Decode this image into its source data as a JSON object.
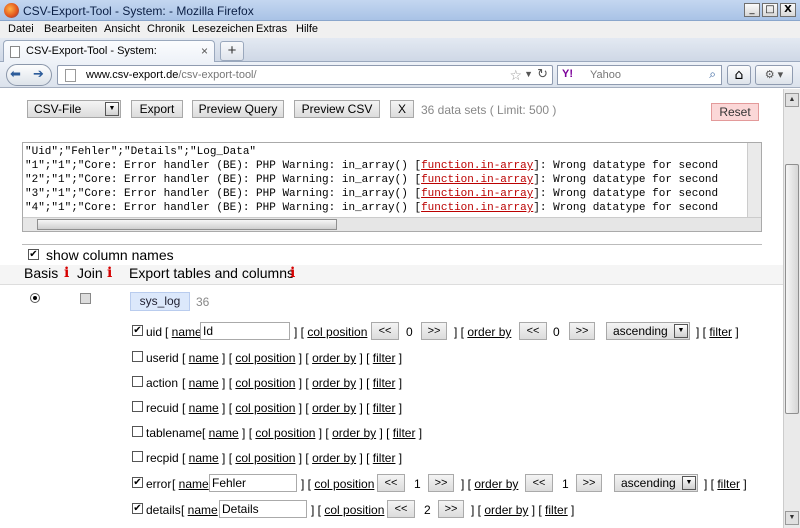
{
  "window": {
    "title": "CSV-Export-Tool - System: - Mozilla Firefox",
    "min": "_",
    "max": "□",
    "close": "X"
  },
  "menu": [
    "Datei",
    "Bearbeiten",
    "Ansicht",
    "Chronik",
    "Lesezeichen",
    "Extras",
    "Hilfe"
  ],
  "tab": {
    "label": "CSV-Export-Tool - System:",
    "close": "×",
    "new": "+"
  },
  "nav": {
    "url_host": "www.csv-export.de",
    "url_path": "/csv-export-tool/",
    "search_engine": "Y!",
    "search_placeholder": "Yahoo"
  },
  "toolbar": {
    "format": "CSV-File",
    "export": "Export",
    "preview_query": "Preview Query",
    "preview_csv": "Preview CSV",
    "x": "X",
    "status": "36 data sets ( Limit: 500 )",
    "reset": "Reset"
  },
  "csv": {
    "header": "\"Uid\";\"Fehler\";\"Details\";\"Log_Data\"",
    "rows": [
      {
        "prefix": "\"1\";\"1\";\"Core: Error handler (BE): PHP Warning: in_array() [",
        "link": "function.in-array",
        "suffix": "]: Wrong datatype for second"
      },
      {
        "prefix": "\"2\";\"1\";\"Core: Error handler (BE): PHP Warning: in_array() [",
        "link": "function.in-array",
        "suffix": "]: Wrong datatype for second"
      },
      {
        "prefix": "\"3\";\"1\";\"Core: Error handler (BE): PHP Warning: in_array() [",
        "link": "function.in-array",
        "suffix": "]: Wrong datatype for second"
      },
      {
        "prefix": "\"4\";\"1\";\"Core: Error handler (BE): PHP Warning: in_array() [",
        "link": "function.in-array",
        "suffix": "]: Wrong datatype for second"
      }
    ]
  },
  "options": {
    "show_column_names": "show column names"
  },
  "headers": {
    "basis": "Basis",
    "join": "Join",
    "export": "Export tables and columns",
    "info": "i"
  },
  "table": {
    "name": "sys_log",
    "count": "36"
  },
  "labels": {
    "name": "name",
    "col_position": "col position",
    "order_by": "order by",
    "filter": "filter",
    "prev": "<<",
    "next": ">>",
    "ascending": "ascending"
  },
  "columns": [
    {
      "name": "uid",
      "checked": true,
      "alias": "Id",
      "pos": "0",
      "order": "0"
    },
    {
      "name": "userid",
      "checked": false
    },
    {
      "name": "action",
      "checked": false
    },
    {
      "name": "recuid",
      "checked": false
    },
    {
      "name": "tablename",
      "checked": false
    },
    {
      "name": "recpid",
      "checked": false
    },
    {
      "name": "error",
      "checked": true,
      "alias": "Fehler",
      "pos": "1",
      "order": "1"
    },
    {
      "name": "details",
      "checked": true,
      "alias": "Details",
      "pos": "2"
    }
  ]
}
